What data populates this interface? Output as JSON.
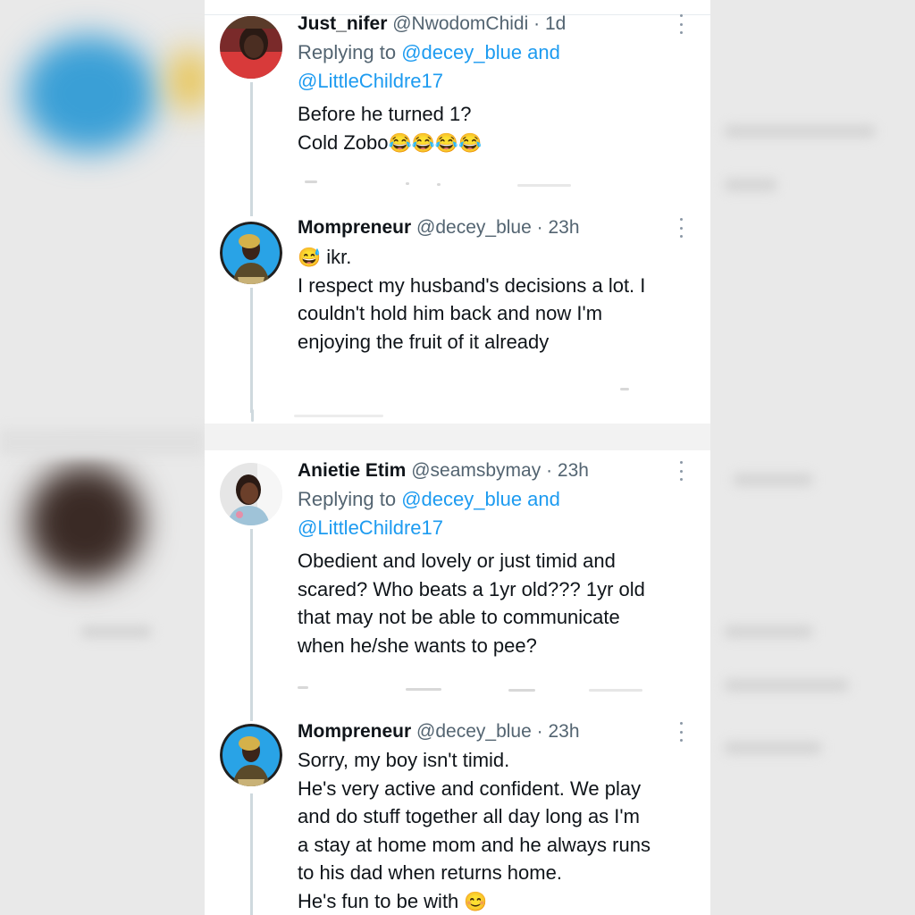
{
  "tweets": [
    {
      "name": "Just_nifer",
      "handle": "@NwodomChidi",
      "dot": "·",
      "time": "1d",
      "replying_prefix": "Replying to ",
      "replying_user1": "@decey_blue",
      "replying_and": " and",
      "replying_user2": "@LittleChildre17",
      "lines": [
        "Before he turned 1?",
        "Cold Zobo"
      ],
      "emoji": "😂😂😂😂"
    },
    {
      "name": "Mompreneur",
      "handle": "@decey_blue",
      "dot": "·",
      "time": "23h",
      "first_emoji": "😅",
      "lines": [
        "ikr.",
        "I respect my husband's decisions a lot. I",
        "couldn't hold him back and now I'm",
        "enjoying the fruit of it already"
      ]
    },
    {
      "name": "Anietie Etim",
      "handle": "@seamsbymay",
      "dot": "·",
      "time": "23h",
      "replying_prefix": "Replying to ",
      "replying_user1": "@decey_blue",
      "replying_and": " and",
      "replying_user2": "@LittleChildre17",
      "lines": [
        "Obedient and lovely or just timid and",
        "scared? Who beats a 1yr old??? 1yr old",
        "that may not be able to communicate",
        "when he/she wants to pee?"
      ]
    },
    {
      "name": "Mompreneur",
      "handle": "@decey_blue",
      "dot": "·",
      "time": "23h",
      "lines": [
        "Sorry, my boy isn't timid.",
        "He's very active and confident. We play",
        "and do stuff together all day long as I'm",
        "a stay at home mom and he always runs",
        "to his dad when returns home.",
        "He's fun to be with"
      ],
      "end_emoji": "😊"
    }
  ],
  "colors": {
    "link": "#1d9bf0",
    "muted": "#536471",
    "text": "#0f1419",
    "thread_line": "#cfd9de"
  },
  "icons": [
    "more-options-icon",
    "avatar"
  ]
}
